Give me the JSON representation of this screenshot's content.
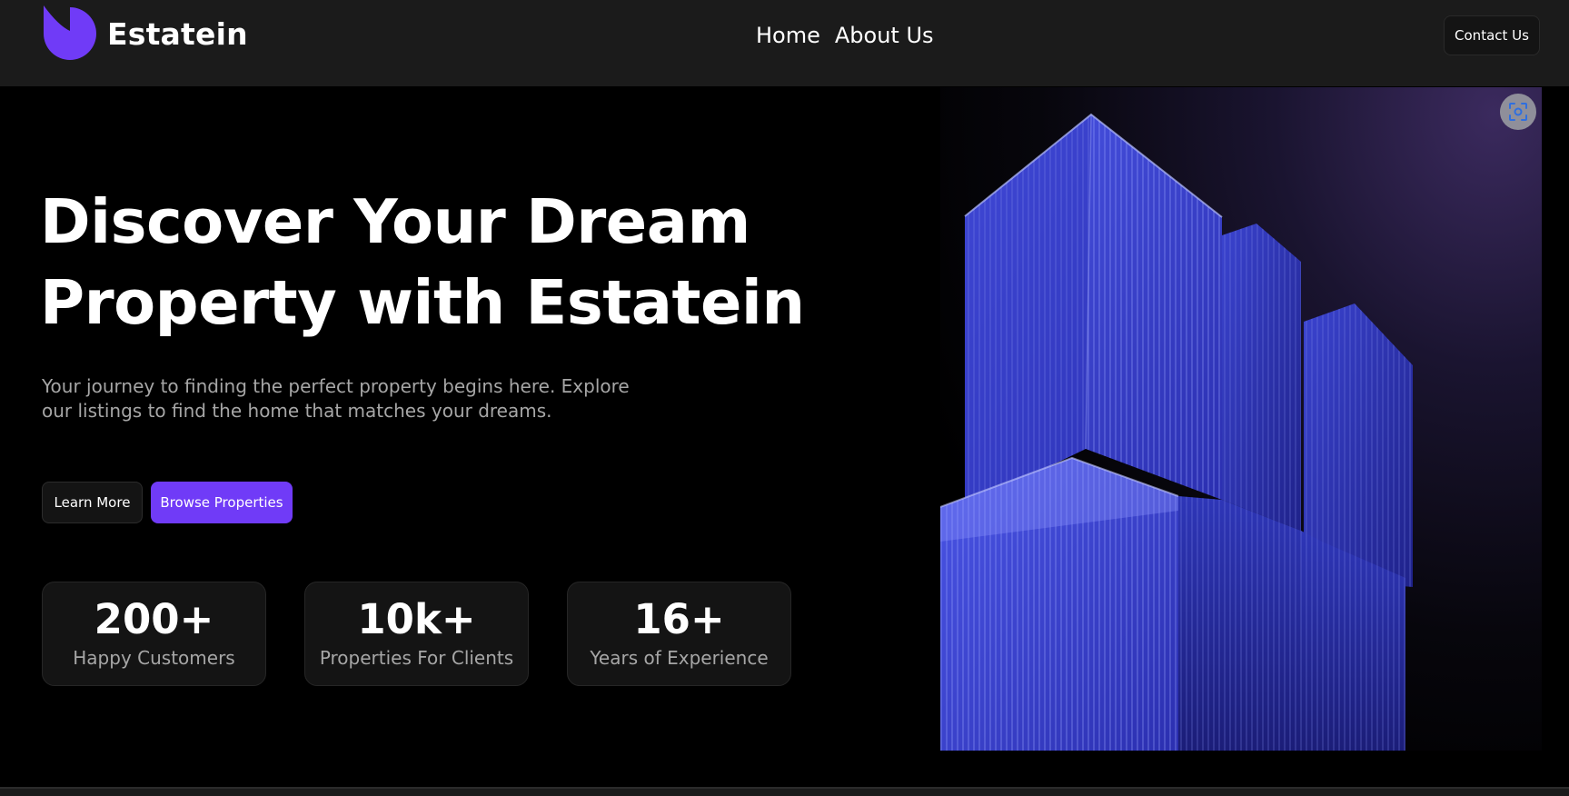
{
  "brand": {
    "name": "Estatein",
    "accent_color": "#703bf7",
    "logo_icon": "estatein-logo-icon"
  },
  "nav": {
    "items": [
      {
        "label": "Home"
      },
      {
        "label": "About Us"
      }
    ],
    "contact_label": "Contact Us"
  },
  "hero": {
    "title_lines": [
      "Discover Your Dream",
      "Property with Estatein"
    ],
    "subtitle_lines": [
      "Your journey to finding the perfect property begins here. Explore",
      "our listings to find the home that matches your dreams."
    ],
    "buttons": {
      "learn_more": "Learn More",
      "browse": "Browse Properties"
    },
    "stats": [
      {
        "value": "200+",
        "label": "Happy Customers"
      },
      {
        "value": "10k+",
        "label": "Properties For Clients"
      },
      {
        "value": "16+",
        "label": "Years of Experience"
      }
    ],
    "image_icon": "image-scan-icon",
    "image_subject": "building-image"
  }
}
